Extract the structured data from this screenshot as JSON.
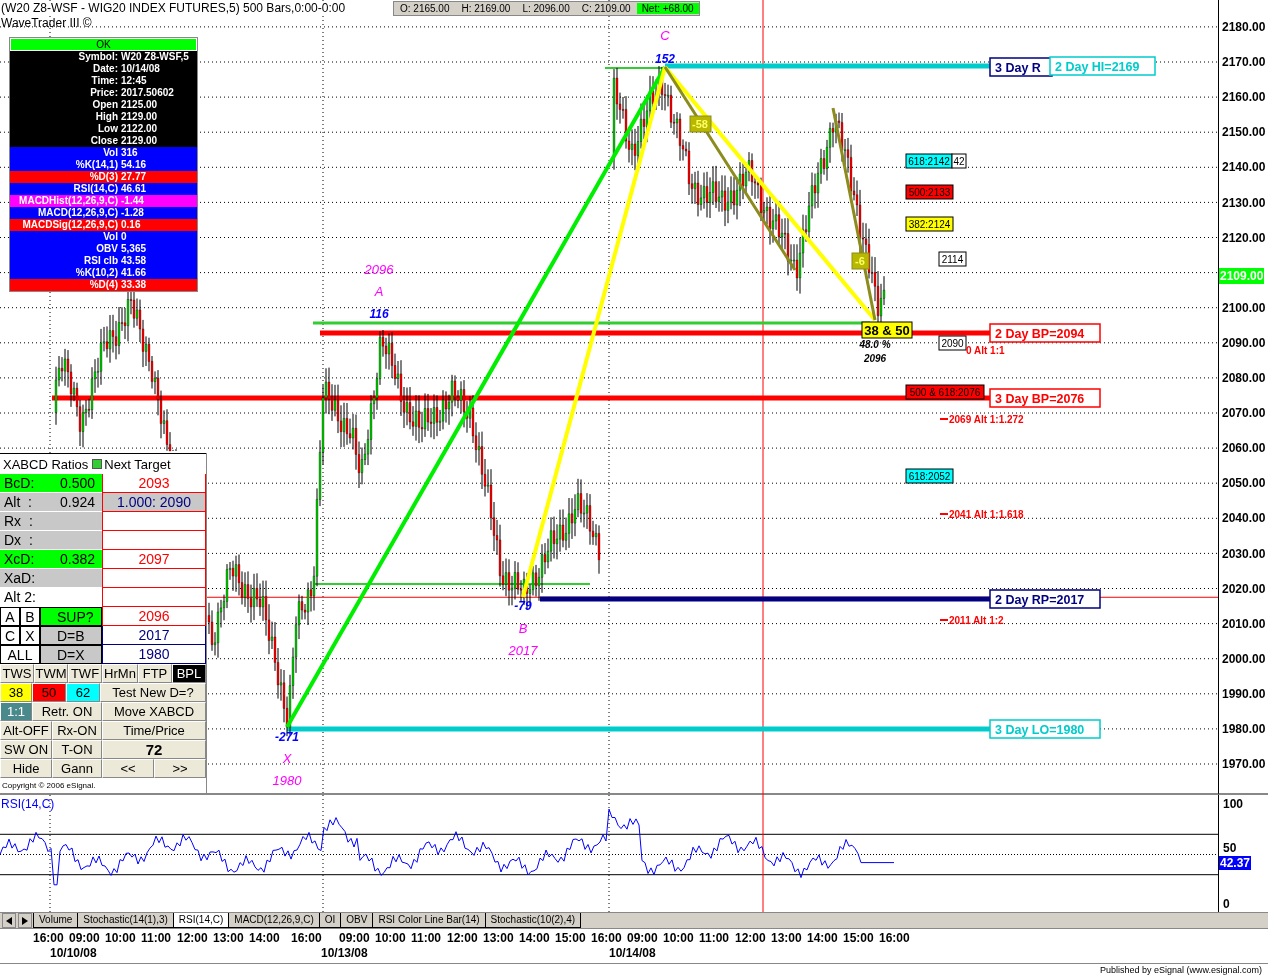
{
  "header": {
    "title": "(W20 Z8-WSF - WIG20 INDEX FUTURES,5) 500 Bars,0:00-0:00",
    "subtitle": "WaveTrader III ©",
    "quote": [
      "O: 2165.00",
      "H: 2169.00",
      "L: 2096.00",
      "C: 2109.00"
    ],
    "net": "Net: +68.00"
  },
  "info_panel": {
    "status": "OK",
    "rows": [
      {
        "label": "Symbol:",
        "value": "W20 Z8-WSF,5",
        "color": "#000000"
      },
      {
        "label": "Date:",
        "value": "10/14/08",
        "color": "#000000"
      },
      {
        "label": "Time:",
        "value": "12:45",
        "color": "#000000"
      },
      {
        "label": "Price:",
        "value": "2017.50602",
        "color": "#000000"
      },
      {
        "label": "Open",
        "value": "2125.00",
        "color": "#000000"
      },
      {
        "label": "High",
        "value": "2129.00",
        "color": "#000000"
      },
      {
        "label": "Low",
        "value": "2122.00",
        "color": "#000000"
      },
      {
        "label": "Close",
        "value": "2129.00",
        "color": "#000000"
      },
      {
        "label": "Vol",
        "value": "316",
        "color": "#0000ff"
      },
      {
        "label": "%K(14,1)",
        "value": "54.16",
        "color": "#0000ff"
      },
      {
        "label": "%D(3)",
        "value": "27.77",
        "color": "#ff0000"
      },
      {
        "label": "RSI(14,C)",
        "value": "46.61",
        "color": "#0000ff"
      },
      {
        "label": "MACDHist(12,26,9,C)",
        "value": "-1.44",
        "color": "#ff00ff"
      },
      {
        "label": "MACD(12,26,9,C)",
        "value": "-1.28",
        "color": "#0000ff"
      },
      {
        "label": "MACDSig(12,26,9,C)",
        "value": "0.16",
        "color": "#ff0000"
      },
      {
        "label": "Vol",
        "value": "0",
        "color": "#0000ff"
      },
      {
        "label": "OBV",
        "value": "5,365",
        "color": "#0000ff"
      },
      {
        "label": "RSI clb",
        "value": "43.58",
        "color": "#0000ff"
      },
      {
        "label": "%K(10,2)",
        "value": "41.66",
        "color": "#0000ff"
      },
      {
        "label": "%D(4)",
        "value": "33.38",
        "color": "#ff0000"
      }
    ]
  },
  "ratios_panel": {
    "title": "XABCD Ratios",
    "target_title": "Next Target",
    "rows": [
      {
        "label": "BcD:",
        "value": "0.500",
        "target": "2093",
        "kind": "hit"
      },
      {
        "label": "Alt  :",
        "value": "0.924",
        "target": "1.000: 2090",
        "kind": "grey"
      },
      {
        "label": "Rx  :",
        "kind": "grey"
      },
      {
        "label": "Dx  :",
        "kind": "grey"
      },
      {
        "label": "XcD:",
        "value": "0.382",
        "target": "2097",
        "kind": "hit"
      },
      {
        "label": "XaD:",
        "kind": "grey"
      },
      {
        "label": "Alt 2:",
        "kind": "blank"
      }
    ],
    "point_rows": [
      {
        "keys": [
          "A",
          "B"
        ],
        "label": "SUP?",
        "target": "2096",
        "kind": "hit"
      },
      {
        "keys": [
          "C",
          "X"
        ],
        "label": "D=B",
        "target": "2017",
        "kind": "grey"
      },
      {
        "keys": [
          "ALL"
        ],
        "label": "D=X",
        "target": "1980",
        "kind": "grey"
      }
    ],
    "button_rows": [
      [
        {
          "label": "TWS",
          "selected": false
        },
        {
          "label": "TWM",
          "selected": false
        },
        {
          "label": "TWF",
          "selected": false
        },
        {
          "label": "HrMn",
          "selected": false
        },
        {
          "label": "FTP",
          "selected": false
        },
        {
          "label": "BPL",
          "selected": true
        }
      ],
      [
        {
          "label": "38",
          "color": "#ffff00"
        },
        {
          "label": "50",
          "color": "#ff0000"
        },
        {
          "label": "62",
          "color": "#00ffff"
        },
        {
          "label": "Test New D=?"
        }
      ],
      [
        {
          "label": "1:1",
          "color": "#4a8a8c"
        },
        {
          "label": "Retr. ON"
        },
        {
          "label": "Move XABCD"
        }
      ],
      [
        {
          "label": "Alt-OFF"
        },
        {
          "label": "Rx-ON"
        },
        {
          "label": "Time/Price"
        }
      ],
      [
        {
          "label": "SW ON"
        },
        {
          "label": "T-ON"
        },
        {
          "label": "72"
        }
      ],
      [
        {
          "label": "Hide"
        },
        {
          "label": "Gann"
        },
        {
          "label": "<<"
        },
        {
          "label": ">>"
        }
      ]
    ],
    "copyright": "Copyright © 2006 eSignal."
  },
  "pattern_points": [
    {
      "letter": "X",
      "price": "1980",
      "count": "-271"
    },
    {
      "letter": "A",
      "price": "2096",
      "count": "116"
    },
    {
      "letter": "B",
      "price": "2017",
      "count": "-79"
    },
    {
      "letter": "C",
      "count": "152"
    }
  ],
  "levels": [
    {
      "label": "3 Day R",
      "color": "#000080"
    },
    {
      "label": "2 Day HI=2169",
      "color": "#00cccc"
    },
    {
      "label": "2 Day BP=2094",
      "color": "#ff0000"
    },
    {
      "label": "3 Day BP=2076",
      "color": "#ff0000"
    },
    {
      "label": "2 Day RP=2017",
      "color": "#000080"
    },
    {
      "label": "3 Day LO=1980",
      "color": "#00cccc"
    }
  ],
  "fib_boxes": [
    {
      "text": "618:2142",
      "color": "#00ffff"
    },
    {
      "text": "42"
    },
    {
      "text": "500:2133",
      "color": "#ff0000"
    },
    {
      "text": "382:2124",
      "color": "#ffff00"
    },
    {
      "text": "2114"
    },
    {
      "text": "2090"
    },
    {
      "text": "500 & 618:2076",
      "color": "#ff0000"
    },
    {
      "text": "618:2052",
      "color": "#00ffff"
    }
  ],
  "alt_notes": [
    "0 Alt 1:1",
    "2069 Alt 1:1.272",
    "2041 Alt 1:1.618",
    "2011 Alt 1:2"
  ],
  "markers": {
    "retracement": "38 & 50",
    "percent": "48.0 %",
    "price": "2096",
    "legs": [
      "-58",
      "-6"
    ]
  },
  "price_axis": {
    "labels": [
      "2180.00",
      "2170.00",
      "2160.00",
      "2150.00",
      "2140.00",
      "2130.00",
      "2120.00",
      "2100.00",
      "2090.00",
      "2080.00",
      "2070.00",
      "2060.00",
      "2050.00",
      "2040.00",
      "2030.00",
      "2020.00",
      "2010.00",
      "2000.00",
      "1990.00",
      "1980.00",
      "1970.00"
    ],
    "current": "2109.00"
  },
  "rsi_panel": {
    "title": "RSI(14,C)",
    "axis": [
      "100",
      "50",
      "0"
    ],
    "value": "42.37"
  },
  "tabs": [
    {
      "label": "Volume",
      "selected": false
    },
    {
      "label": "Stochastic(14(1),3)",
      "selected": false
    },
    {
      "label": "RSI(14,C)",
      "selected": true
    },
    {
      "label": "MACD(12,26,9,C)",
      "selected": false
    },
    {
      "label": "OI",
      "selected": false
    },
    {
      "label": "OBV",
      "selected": false
    },
    {
      "label": "RSI Color Line Bar(14)",
      "selected": false
    },
    {
      "label": "Stochastic(10(2),4)",
      "selected": false
    }
  ],
  "time_axis": {
    "times": [
      "16:00",
      "09:00",
      "10:00",
      "11:00",
      "12:00",
      "13:00",
      "14:00",
      "16:00",
      "09:00",
      "10:00",
      "11:00",
      "12:00",
      "13:00",
      "14:00",
      "15:00",
      "16:00",
      "09:00",
      "10:00",
      "11:00",
      "12:00",
      "13:00",
      "14:00",
      "15:00",
      "16:00"
    ],
    "dates": [
      "10/10/08",
      "10/13/08",
      "10/14/08"
    ]
  },
  "status_bar": "Published by eSignal (www.esignal.com)"
}
